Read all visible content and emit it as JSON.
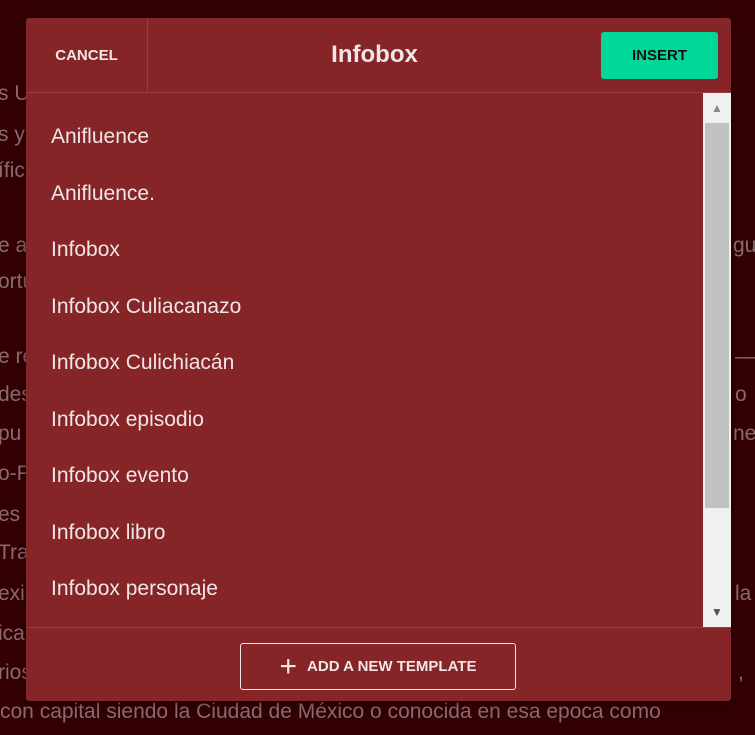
{
  "background": {
    "left_fragments": [
      "s U",
      "s y",
      "ífic",
      "e a",
      "ortu",
      "e re",
      "des",
      "pu",
      "o-F",
      "es",
      "Tra",
      "exic",
      "ica",
      "rios"
    ],
    "right_fragments": [
      "gua",
      "—",
      "o",
      "ne",
      "la",
      ","
    ],
    "bottom_line": "con capital siendo la Ciudad de México o conocida en esa epoca como"
  },
  "dialog": {
    "cancel_label": "CANCEL",
    "title": "Infobox",
    "insert_label": "INSERT",
    "items": [
      "Anifluence",
      "Anifluence.",
      "Infobox",
      "Infobox Culiacanazo",
      "Infobox Culichiacán",
      "Infobox episodio",
      "Infobox evento",
      "Infobox libro",
      "Infobox personaje"
    ],
    "add_template_label": "ADD A NEW TEMPLATE",
    "accent_color": "#00d89a"
  }
}
